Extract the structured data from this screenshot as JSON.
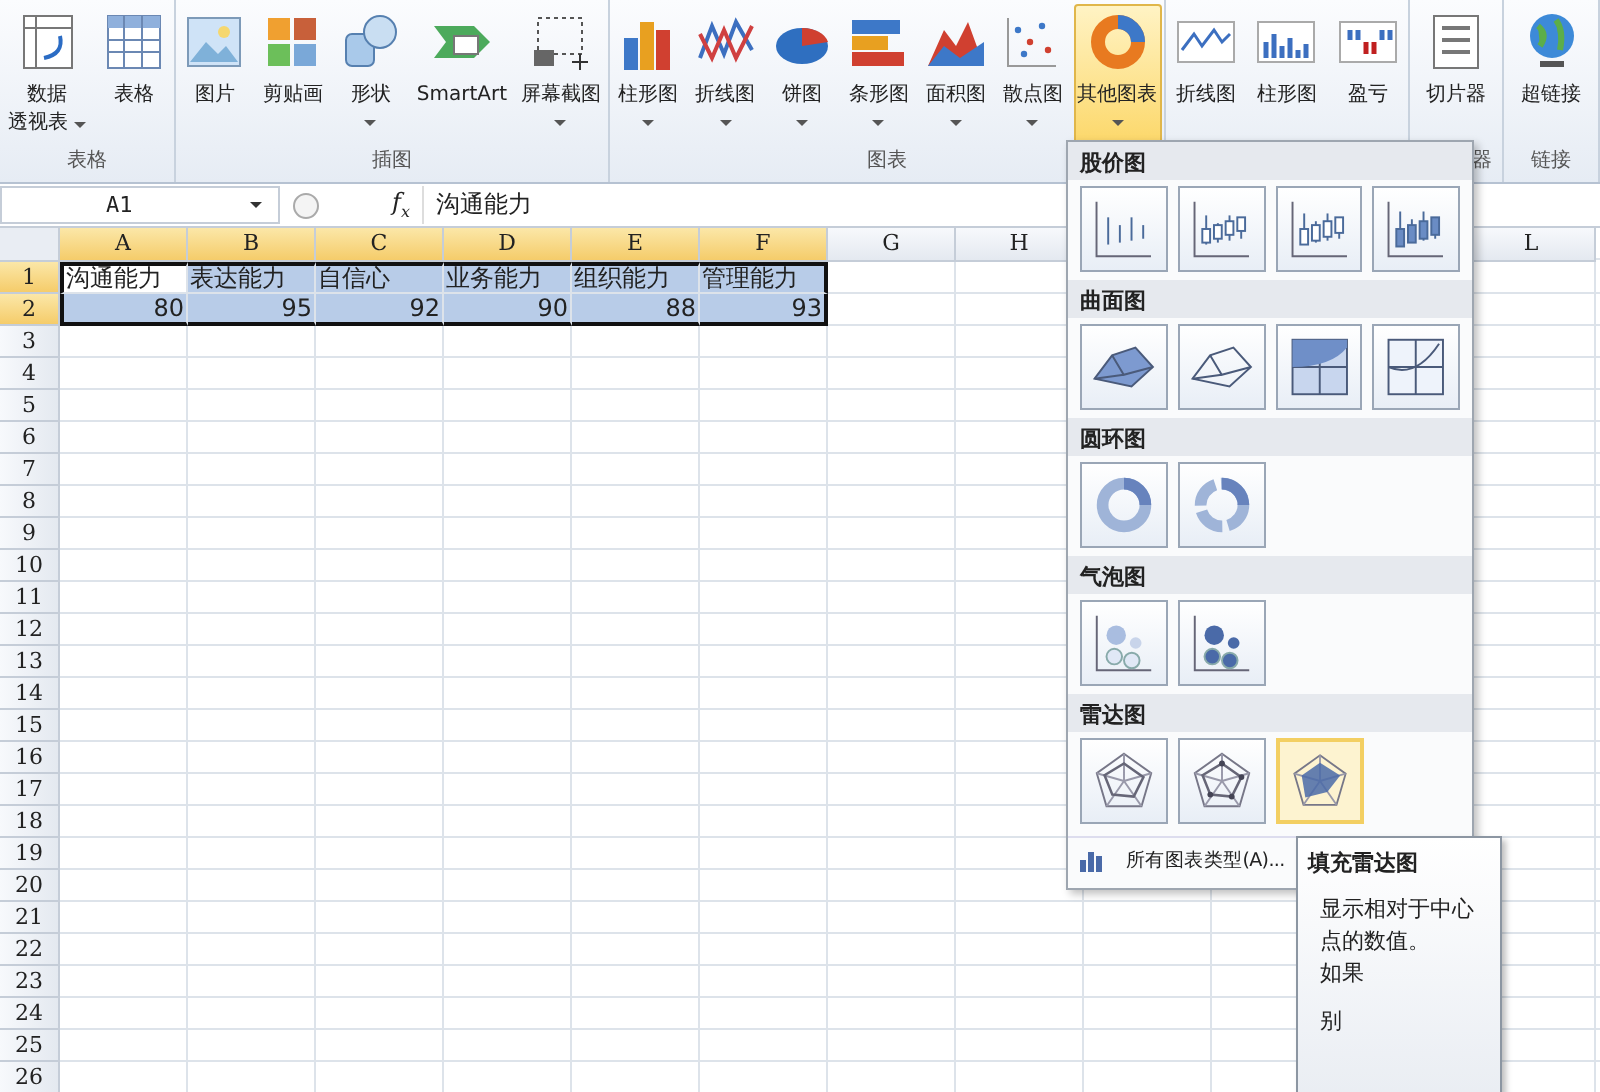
{
  "ribbon": {
    "groups": [
      {
        "label": "表格",
        "buttons": [
          {
            "lines": [
              "数据",
              "透视表"
            ],
            "dropdown": true,
            "selected": false
          },
          {
            "lines": [
              "表格"
            ],
            "dropdown": false,
            "selected": false
          }
        ]
      },
      {
        "label": "插图",
        "buttons": [
          {
            "lines": [
              "图片"
            ],
            "dropdown": false,
            "selected": false
          },
          {
            "lines": [
              "剪贴画"
            ],
            "dropdown": false,
            "selected": false
          },
          {
            "lines": [
              "形状"
            ],
            "dropdown": true,
            "selected": false
          },
          {
            "lines": [
              "SmartArt"
            ],
            "dropdown": false,
            "selected": false
          },
          {
            "lines": [
              "屏幕截图"
            ],
            "dropdown": true,
            "selected": false
          }
        ]
      },
      {
        "label": "图表",
        "buttons": [
          {
            "lines": [
              "柱形图"
            ],
            "dropdown": true,
            "selected": false
          },
          {
            "lines": [
              "折线图"
            ],
            "dropdown": true,
            "selected": false
          },
          {
            "lines": [
              "饼图"
            ],
            "dropdown": true,
            "selected": false
          },
          {
            "lines": [
              "条形图"
            ],
            "dropdown": true,
            "selected": false
          },
          {
            "lines": [
              "面积图"
            ],
            "dropdown": true,
            "selected": false
          },
          {
            "lines": [
              "散点图"
            ],
            "dropdown": true,
            "selected": false
          },
          {
            "lines": [
              "其他图表"
            ],
            "dropdown": true,
            "selected": true
          }
        ]
      },
      {
        "buttons": [
          {
            "lines": [
              "折线图"
            ],
            "dropdown": false,
            "selected": false
          },
          {
            "lines": [
              "柱形图"
            ],
            "dropdown": false,
            "selected": false
          },
          {
            "lines": [
              "盈亏"
            ],
            "dropdown": false,
            "selected": false
          }
        ]
      },
      {
        "label": "器",
        "buttons": [
          {
            "lines": [
              "切片器"
            ],
            "dropdown": false,
            "selected": false
          }
        ]
      },
      {
        "label": "链接",
        "buttons": [
          {
            "lines": [
              "超链接"
            ],
            "dropdown": false,
            "selected": false
          }
        ]
      }
    ]
  },
  "formula_bar": {
    "name_box": "A1",
    "function_label": "f$_{x}$",
    "formula": "沟通能力"
  },
  "sheet": {
    "columns": [
      {
        "label": "A",
        "selected": true
      },
      {
        "label": "B",
        "selected": true
      },
      {
        "label": "C",
        "selected": true
      },
      {
        "label": "D",
        "selected": true
      },
      {
        "label": "E",
        "selected": true
      },
      {
        "label": "F",
        "selected": true
      },
      {
        "label": "G",
        "selected": false
      },
      {
        "label": "H",
        "selected": false
      },
      {
        "label": "L",
        "selected": false
      }
    ],
    "rows": [
      {
        "number": "1",
        "selected": true,
        "cells": [
          {
            "text": "沟通能力",
            "active": true
          },
          {
            "text": "表达能力",
            "active": false
          },
          {
            "text": "自信心",
            "active": false
          },
          {
            "text": "业务能力",
            "active": false
          },
          {
            "text": "组织能力",
            "active": false
          },
          {
            "text": "管理能力",
            "active": false
          }
        ]
      },
      {
        "number": "2",
        "selected": true,
        "cells": [
          {
            "text": "80",
            "active": false
          },
          {
            "text": "95",
            "active": false
          },
          {
            "text": "92",
            "active": false
          },
          {
            "text": "90",
            "active": false
          },
          {
            "text": "88",
            "active": false
          },
          {
            "text": "93",
            "active": false
          }
        ]
      },
      {
        "number": "3",
        "selected": false
      },
      {
        "number": "4",
        "selected": false
      },
      {
        "number": "5",
        "selected": false
      },
      {
        "number": "6",
        "selected": false
      },
      {
        "number": "7",
        "selected": false
      },
      {
        "number": "8",
        "selected": false
      },
      {
        "number": "9",
        "selected": false
      },
      {
        "number": "10",
        "selected": false
      },
      {
        "number": "11",
        "selected": false
      },
      {
        "number": "12",
        "selected": false
      },
      {
        "number": "13",
        "selected": false
      },
      {
        "number": "14",
        "selected": false
      },
      {
        "number": "15",
        "selected": false
      },
      {
        "number": "16",
        "selected": false
      },
      {
        "number": "17",
        "selected": false
      },
      {
        "number": "18",
        "selected": false
      },
      {
        "number": "19",
        "selected": false
      },
      {
        "number": "20",
        "selected": false
      },
      {
        "number": "21",
        "selected": false
      },
      {
        "number": "22",
        "selected": false
      },
      {
        "number": "23",
        "selected": false
      },
      {
        "number": "24",
        "selected": false
      },
      {
        "number": "25",
        "selected": false
      },
      {
        "number": "26",
        "selected": false
      }
    ]
  },
  "chart_menu": {
    "sections": [
      {
        "title": "股价图",
        "kind": "stock",
        "items": [
          {
            "selected": false
          },
          {
            "selected": false
          },
          {
            "selected": false
          },
          {
            "selected": false
          }
        ]
      },
      {
        "title": "曲面图",
        "kind": "surface",
        "items": [
          {
            "selected": false
          },
          {
            "selected": false
          },
          {
            "selected": false
          },
          {
            "selected": false
          }
        ]
      },
      {
        "title": "圆环图",
        "kind": "doughnut",
        "items": [
          {
            "selected": false
          },
          {
            "selected": false
          }
        ]
      },
      {
        "title": "气泡图",
        "kind": "bubble",
        "items": [
          {
            "selected": false
          },
          {
            "selected": false
          }
        ]
      },
      {
        "title": "雷达图",
        "kind": "radar",
        "items": [
          {
            "selected": false
          },
          {
            "selected": false
          },
          {
            "selected": true
          }
        ]
      }
    ],
    "footer": "所有图表类型(A)..."
  },
  "tooltip": {
    "title": "填充雷达图",
    "lines": [
      "显示相对于中心点的数值。",
      "如果",
      "别"
    ]
  }
}
